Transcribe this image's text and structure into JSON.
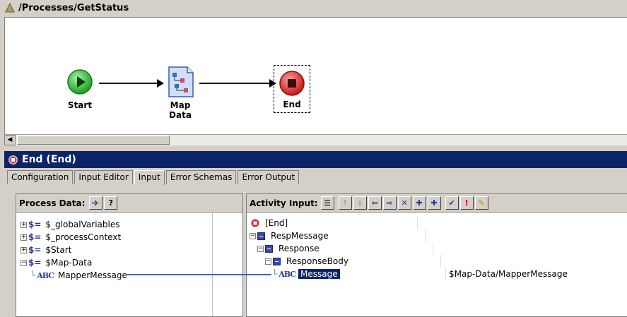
{
  "window": {
    "title": "/Processes/GetStatus"
  },
  "process": {
    "nodes": [
      {
        "label": "Start"
      },
      {
        "label": "Map Data"
      },
      {
        "label": "End"
      }
    ]
  },
  "activity": {
    "title": "End (End)"
  },
  "tabs": [
    "Configuration",
    "Input Editor",
    "Input",
    "Error Schemas",
    "Error Output"
  ],
  "active_tab": "Input",
  "process_data": {
    "header": "Process Data:",
    "items": [
      {
        "label": "$_globalVariables"
      },
      {
        "label": "$_processContext"
      },
      {
        "label": "$Start"
      },
      {
        "label": "$Map-Data"
      },
      {
        "label": "MapperMessage"
      }
    ]
  },
  "activity_input": {
    "header": "Activity Input:",
    "items": [
      {
        "label": "[End]"
      },
      {
        "label": "RespMessage"
      },
      {
        "label": "Response"
      },
      {
        "label": "ResponseBody"
      },
      {
        "label": "Message",
        "value": "$Map-Data/MapperMessage"
      }
    ]
  },
  "colors": {
    "selection": "#0a246a",
    "mapping_line": "#5060b0"
  }
}
